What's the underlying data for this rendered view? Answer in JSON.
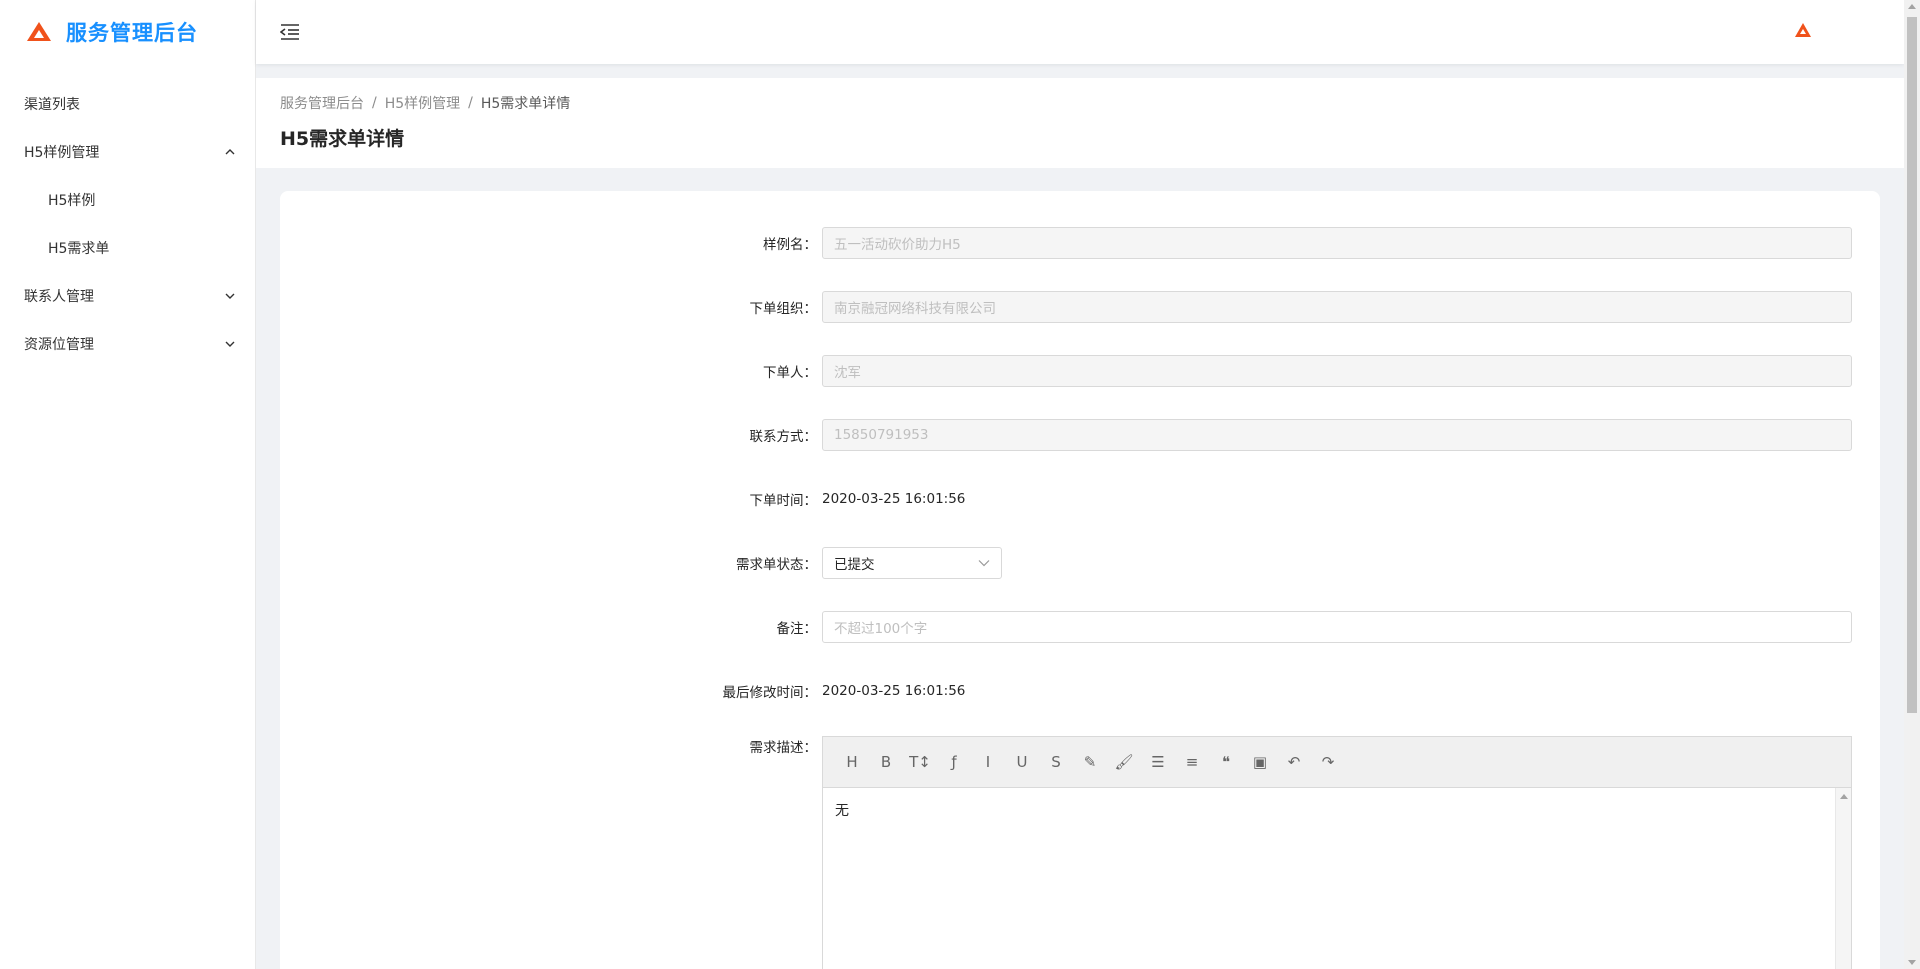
{
  "app": {
    "title": "服务管理后台",
    "accent_color": "#1890ff",
    "logo_color": "#f0521b"
  },
  "sidebar": {
    "items": [
      {
        "label": "渠道列表",
        "icon": "none"
      },
      {
        "label": "H5样例管理",
        "icon": "chevron-up-icon"
      },
      {
        "label": "H5样例",
        "icon": "none"
      },
      {
        "label": "H5需求单",
        "icon": "none"
      },
      {
        "label": "联系人管理",
        "icon": "chevron-down-icon"
      },
      {
        "label": "资源位管理",
        "icon": "chevron-down-icon"
      }
    ]
  },
  "header": {
    "fold_icon": "menu-fold-icon"
  },
  "breadcrumb": [
    "服务管理后台",
    "H5样例管理",
    "H5需求单详情"
  ],
  "page_title": "H5需求单详情",
  "form": {
    "sample_name": {
      "label": "样例名：",
      "value": "五一活动砍价助力H5"
    },
    "order_org": {
      "label": "下单组织：",
      "value": "南京融冠网络科技有限公司"
    },
    "orderer": {
      "label": "下单人：",
      "value": "沈军"
    },
    "contact": {
      "label": "联系方式：",
      "value": "15850791953"
    },
    "order_time": {
      "label": "下单时间：",
      "value": "2020-03-25 16:01:56"
    },
    "status": {
      "label": "需求单状态：",
      "value": "已提交"
    },
    "remark": {
      "label": "备注：",
      "placeholder": "不超过100个字"
    },
    "modified_time": {
      "label": "最后修改时间：",
      "value": "2020-03-25 16:01:56"
    },
    "description": {
      "label": "需求描述：",
      "value": "无"
    }
  },
  "editor_toolbar": [
    {
      "name": "heading-icon",
      "glyph": "H"
    },
    {
      "name": "bold-icon",
      "glyph": "B"
    },
    {
      "name": "font-size-icon",
      "glyph": "T↕"
    },
    {
      "name": "font-family-icon",
      "glyph": "ƒ"
    },
    {
      "name": "italic-icon",
      "glyph": "I"
    },
    {
      "name": "underline-icon",
      "glyph": "U"
    },
    {
      "name": "strikethrough-icon",
      "glyph": "S"
    },
    {
      "name": "highlight-icon",
      "glyph": "✎"
    },
    {
      "name": "brush-icon",
      "glyph": "🖌"
    },
    {
      "name": "list-icon",
      "glyph": "☰"
    },
    {
      "name": "align-icon",
      "glyph": "≡"
    },
    {
      "name": "quote-icon",
      "glyph": "❝"
    },
    {
      "name": "image-icon",
      "glyph": "▣"
    },
    {
      "name": "undo-icon",
      "glyph": "↶"
    },
    {
      "name": "redo-icon",
      "glyph": "↷"
    }
  ]
}
